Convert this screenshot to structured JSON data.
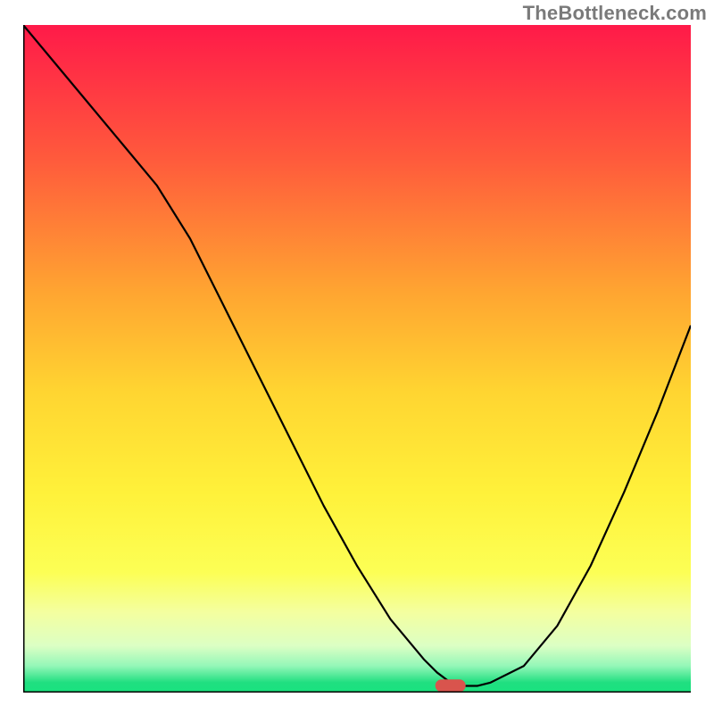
{
  "watermark": "TheBottleneck.com",
  "chart_data": {
    "type": "line",
    "title": "",
    "xlabel": "",
    "ylabel": "",
    "xlim": [
      0,
      100
    ],
    "ylim": [
      0,
      100
    ],
    "grid": false,
    "x": [
      0,
      5,
      10,
      15,
      20,
      25,
      30,
      35,
      40,
      45,
      50,
      55,
      60,
      62,
      64,
      66,
      68,
      70,
      75,
      80,
      85,
      90,
      95,
      100
    ],
    "values": [
      100,
      94,
      88,
      82,
      76,
      68,
      58,
      48,
      38,
      28,
      19,
      11,
      5,
      3,
      1.5,
      1,
      1,
      1.5,
      4,
      10,
      19,
      30,
      42,
      55
    ],
    "marker": {
      "x": 64,
      "y": 0.5,
      "color": "#d9544d"
    },
    "gradient_stops": [
      {
        "offset": 0.0,
        "color": "#ff1a49"
      },
      {
        "offset": 0.2,
        "color": "#ff5a3c"
      },
      {
        "offset": 0.4,
        "color": "#ffa531"
      },
      {
        "offset": 0.55,
        "color": "#ffd531"
      },
      {
        "offset": 0.7,
        "color": "#fff13a"
      },
      {
        "offset": 0.82,
        "color": "#fcff55"
      },
      {
        "offset": 0.88,
        "color": "#f4ffa0"
      },
      {
        "offset": 0.93,
        "color": "#dcffc4"
      },
      {
        "offset": 0.96,
        "color": "#94f7b8"
      },
      {
        "offset": 0.985,
        "color": "#20df80"
      },
      {
        "offset": 1.0,
        "color": "#19e27f"
      }
    ],
    "axis_color": "#000000",
    "line_color": "#000000",
    "line_width": 2.2
  }
}
